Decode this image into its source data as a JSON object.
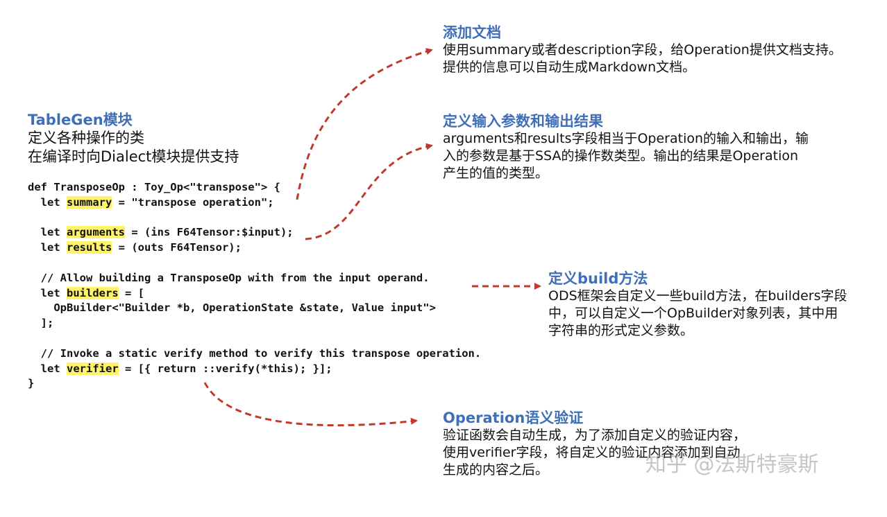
{
  "left": {
    "title": "TableGen模块",
    "line1": "定义各种操作的类",
    "line2": "在编译时向Dialect模块提供支持"
  },
  "code": {
    "l1": "def TransposeOp : Toy_Op<\"transpose\"> {",
    "l2_pre": "  let ",
    "l2_kw": "summary",
    "l2_post": " = \"transpose operation\";",
    "l3_pre": "  let ",
    "l3_kw": "arguments",
    "l3_post": " = (ins F64Tensor:$input);",
    "l4_pre": "  let ",
    "l4_kw": "results",
    "l4_post": " = (outs F64Tensor);",
    "l5": "  // Allow building a TransposeOp with from the input operand.",
    "l6_pre": "  let ",
    "l6_kw": "builders",
    "l6_post": " = [",
    "l7": "    OpBuilder<\"Builder *b, OperationState &state, Value input\">",
    "l8": "  ];",
    "l9": "  // Invoke a static verify method to verify this transpose operation.",
    "l10_pre": "  let ",
    "l10_kw": "verifier",
    "l10_post": " = [{ return ::verify(*this); }];",
    "l11": "}"
  },
  "annotations": {
    "doc": {
      "title": "添加文档",
      "lines": [
        "使用summary或者description字段，给Operation提供文档支持。",
        "提供的信息可以自动生成Markdown文档。"
      ]
    },
    "args": {
      "title": "定义输入参数和输出结果",
      "lines": [
        "arguments和results字段相当于Operation的输入和输出，输",
        "入的参数是基于SSA的操作数类型。输出的结果是Operation",
        "产生的值的类型。"
      ]
    },
    "build": {
      "title": "定义build方法",
      "lines": [
        "ODS框架会自定义一些build方法，在builders字段",
        "中，可以自定义一个OpBuilder对象列表，其中用",
        "字符串的形式定义参数。"
      ]
    },
    "verify": {
      "title": "Operation语义验证",
      "lines": [
        "验证函数会自动生成，为了添加自定义的验证内容，",
        "使用verifier字段，将自定义的验证内容添加到自动",
        "生成的内容之后。"
      ]
    }
  },
  "watermark": "知乎 @法斯特豪斯",
  "colors": {
    "heading": "#3f6fb7",
    "arrow": "#c0392b",
    "highlight": "#fff36b"
  }
}
